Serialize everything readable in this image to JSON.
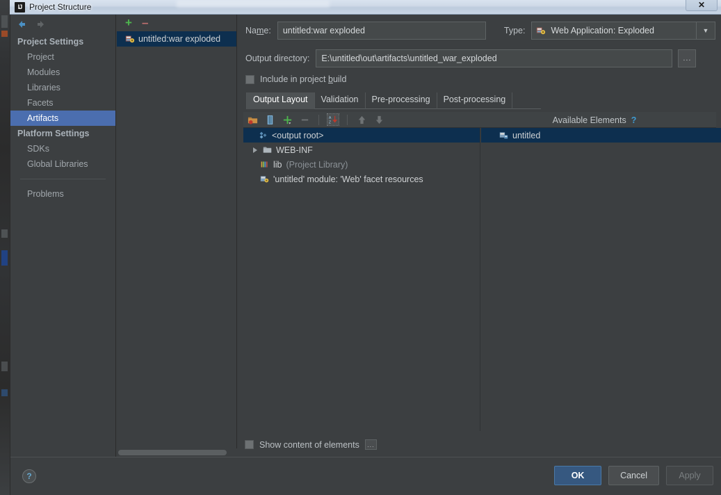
{
  "window": {
    "title": "Project Structure",
    "logo_text": "IJ",
    "close_label": "✕"
  },
  "nav": {
    "back_icon": "arrow-left-icon",
    "forward_icon": "arrow-right-icon"
  },
  "sidebar": {
    "groups": [
      {
        "label": "Project Settings",
        "items": [
          {
            "label": "Project",
            "selected": false
          },
          {
            "label": "Modules",
            "selected": false
          },
          {
            "label": "Libraries",
            "selected": false
          },
          {
            "label": "Facets",
            "selected": false
          },
          {
            "label": "Artifacts",
            "selected": true
          }
        ]
      },
      {
        "label": "Platform Settings",
        "items": [
          {
            "label": "SDKs",
            "selected": false
          },
          {
            "label": "Global Libraries",
            "selected": false
          }
        ]
      }
    ],
    "problems_label": "Problems"
  },
  "artifacts_panel": {
    "toolbar": {
      "add_label": "+",
      "remove_label": "–"
    },
    "items": [
      {
        "label": "untitled:war exploded",
        "icon": "artifact-icon",
        "selected": true
      }
    ]
  },
  "config": {
    "name_label": "Na",
    "name_label_accel": "m",
    "name_label_rest": "e:",
    "name_value": "untitled:war exploded",
    "type_label": "Type:",
    "type_value": "Web Application: Exploded",
    "type_icon": "artifact-icon",
    "type_arrow": "▼",
    "output_dir_label": "Output directory:",
    "output_dir_value": "E:\\untitled\\out\\artifacts\\untitled_war_exploded",
    "browse_label": "...",
    "include_build_label_a": "Include in project ",
    "include_build_accel": "b",
    "include_build_label_b": "uild",
    "include_build_checked": false
  },
  "tabs": [
    {
      "label": "Output Layout",
      "active": true
    },
    {
      "label": "Validation",
      "active": false
    },
    {
      "label": "Pre-processing",
      "active": false
    },
    {
      "label": "Post-processing",
      "active": false
    }
  ],
  "editor_toolbar": {
    "icons": [
      "add-directory-icon",
      "add-archive-icon",
      "add-copy-icon",
      "remove-icon",
      "sort-alphabetically-icon",
      "move-up-icon",
      "move-down-icon"
    ]
  },
  "available_elements": {
    "title": "Available Elements",
    "help_marker": "?",
    "items": [
      {
        "label": "untitled",
        "icon": "module-icon"
      }
    ]
  },
  "output_layout_tree": [
    {
      "label": "<output root>",
      "suffix": "",
      "icon": "output-root-icon",
      "indent": 0,
      "selected": true,
      "twisty": false
    },
    {
      "label": "WEB-INF",
      "suffix": "",
      "icon": "folder-icon",
      "indent": 0,
      "selected": false,
      "twisty": true
    },
    {
      "label": "lib",
      "suffix": " (Project Library)",
      "icon": "library-icon",
      "indent": 1,
      "selected": false,
      "twisty": false
    },
    {
      "label": "'untitled' module: 'Web' facet resources",
      "suffix": "",
      "icon": "facet-icon",
      "indent": 1,
      "selected": false,
      "twisty": false
    }
  ],
  "show_content": {
    "label": "Show content of elements",
    "checked": false,
    "dots_label": "..."
  },
  "footer": {
    "help_label": "?",
    "buttons": [
      {
        "label": "OK",
        "style": "primary"
      },
      {
        "label": "Cancel",
        "style": "normal"
      },
      {
        "label": "Apply",
        "style": "disabled"
      }
    ]
  },
  "colors": {
    "panel_bg": "#3c3f41",
    "selection_blue": "#4b6eaf",
    "tree_selection": "#0d2f4f",
    "primary_button": "#365880",
    "accent_green": "#4eb64e",
    "link_blue": "#3f9ad1"
  }
}
